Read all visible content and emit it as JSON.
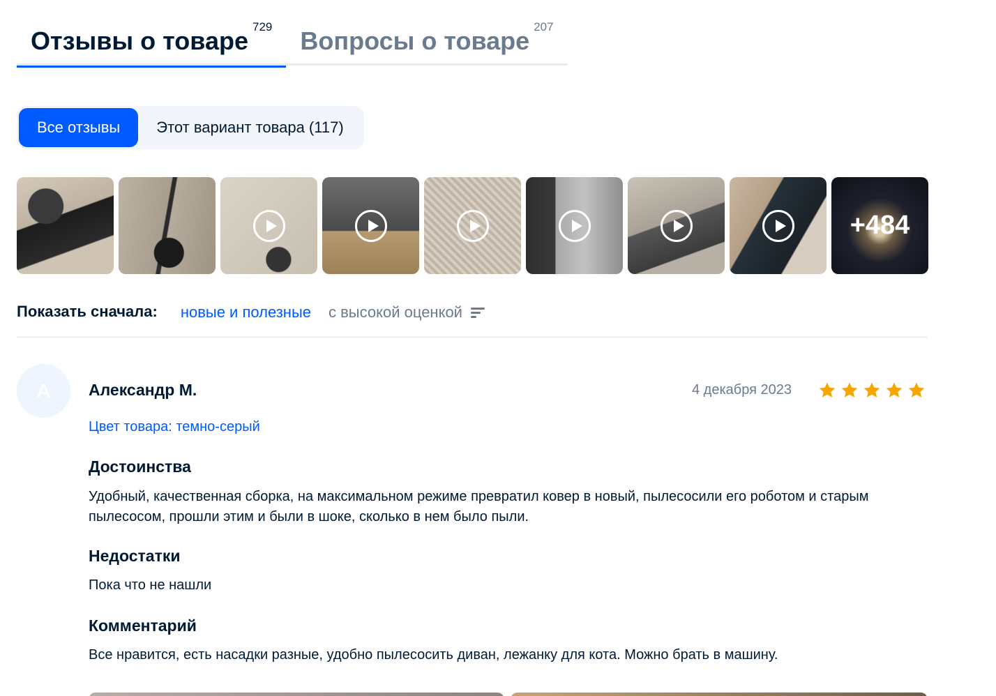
{
  "tabs": [
    {
      "label": "Отзывы о товаре",
      "count": "729"
    },
    {
      "label": "Вопросы о товаре",
      "count": "207"
    }
  ],
  "filter": {
    "all_label": "Все отзывы",
    "variant_label": "Этот вариант товара (117)"
  },
  "media": {
    "more_label": "+484"
  },
  "sort": {
    "label": "Показать сначала:",
    "option_active": "новые и полезные",
    "option_other": "с высокой оценкой"
  },
  "review": {
    "avatar_letter": "А",
    "author": "Александр М.",
    "date": "4 декабря 2023",
    "rating": 5,
    "variant": "Цвет товара: темно-серый",
    "pros_title": "Достоинства",
    "pros_text": "Удобный, качественная сборка, на максимальном режиме превратил ковер в новый, пылесосили его роботом и старым пылесосом, прошли этим и были в шоке, сколько в нем было пыли.",
    "cons_title": "Недостатки",
    "cons_text": "Пока что не нашли",
    "comment_title": "Комментарий",
    "comment_text": "Все нравится, есть насадки разные, удобно пылесосить диван, лежанку для кота. Можно брать в машину."
  },
  "colors": {
    "accent": "#005bff",
    "star": "#f7a600",
    "muted": "#6b7b8e"
  }
}
